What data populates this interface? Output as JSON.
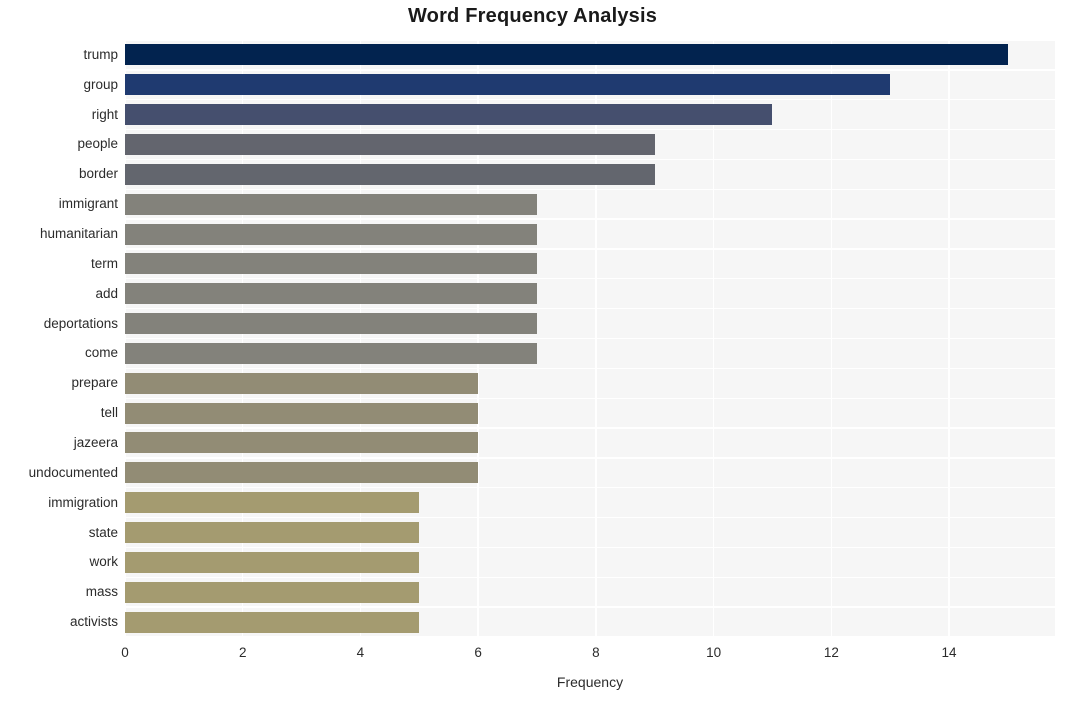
{
  "chart_data": {
    "type": "bar",
    "orientation": "horizontal",
    "title": "Word Frequency Analysis",
    "xlabel": "Frequency",
    "ylabel": "",
    "xlim": [
      0,
      15.8
    ],
    "xticks": [
      0,
      2,
      4,
      6,
      8,
      10,
      12,
      14
    ],
    "grid": true,
    "legend": null,
    "categories": [
      "trump",
      "group",
      "right",
      "people",
      "border",
      "immigrant",
      "humanitarian",
      "term",
      "add",
      "deportations",
      "come",
      "prepare",
      "tell",
      "jazeera",
      "undocumented",
      "immigration",
      "state",
      "work",
      "mass",
      "activists"
    ],
    "values": [
      15,
      13,
      11,
      9,
      9,
      7,
      7,
      7,
      7,
      7,
      7,
      6,
      6,
      6,
      6,
      5,
      5,
      5,
      5,
      5
    ],
    "bar_colors": [
      "#02234f",
      "#1f3a70",
      "#454f6e",
      "#63656e",
      "#63666e",
      "#83827b",
      "#83827b",
      "#83827b",
      "#83827b",
      "#83827b",
      "#83827b",
      "#928c75",
      "#928c75",
      "#928c75",
      "#928c75",
      "#a49b70",
      "#a49b70",
      "#a49b70",
      "#a49b70",
      "#a49b70"
    ]
  },
  "style": {
    "plot_background": "#f6f6f6",
    "gridline_color": "#ffffff",
    "figure_background": "#ffffff",
    "text_color": "#2b2b2b",
    "title_color": "#1a1a1a"
  }
}
